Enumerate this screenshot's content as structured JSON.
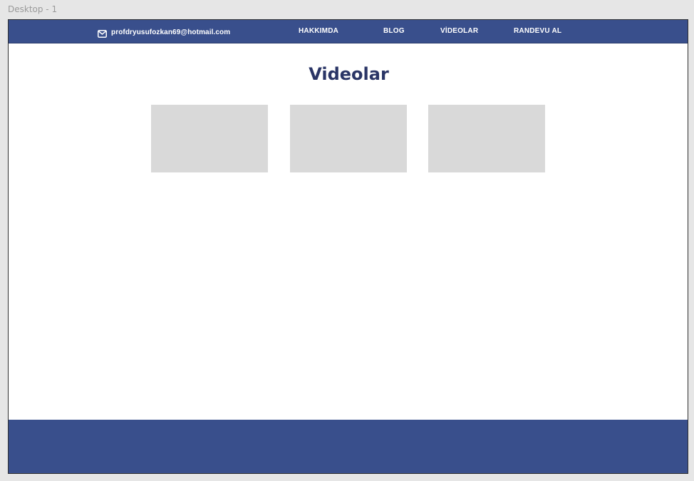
{
  "canvas": {
    "label": "Desktop - 1"
  },
  "header": {
    "email": "profdryusufozkan69@hotmail.com",
    "email_icon": "mail-icon",
    "nav": [
      {
        "label": "HAKKIMDA"
      },
      {
        "label": "BLOG"
      },
      {
        "label": "VİDEOLAR"
      },
      {
        "label": "RANDEVU AL"
      }
    ]
  },
  "main": {
    "title": "Videolar",
    "videos_count_visible": 3
  },
  "colors": {
    "brand": "#394f8c",
    "title": "#2a3566",
    "placeholder": "#d9d9d9",
    "canvas": "#e6e6e6"
  }
}
